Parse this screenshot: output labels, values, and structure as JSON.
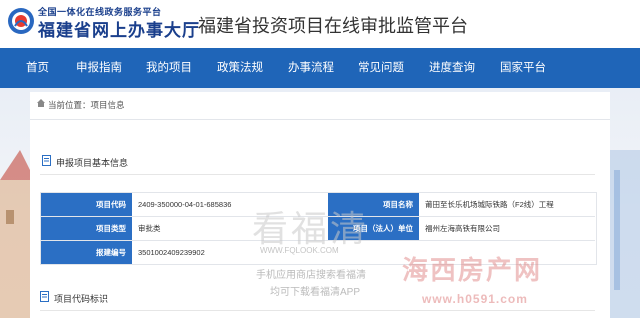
{
  "header": {
    "logo_sub": "全国一体化在线政务服务平台",
    "logo_main": "福建省网上办事大厅",
    "site_title": "福建省投资项目在线审批监管平台"
  },
  "nav": {
    "items": [
      "首页",
      "申报指南",
      "我的项目",
      "政策法规",
      "办事流程",
      "常见问题",
      "进度查询",
      "国家平台"
    ]
  },
  "breadcrumb": {
    "label": "当前位置：项目信息"
  },
  "section1": {
    "title": "申报项目基本信息"
  },
  "info_table": {
    "rows": [
      {
        "label1": "项目代码",
        "value1": "2409-350000-04-01-685836",
        "label2": "项目名称",
        "value2": "莆田至长乐机场城际铁路（F2线）工程"
      },
      {
        "label1": "项目类型",
        "value1": "审批类",
        "label2": "项目（法人）单位",
        "value2": "福州左海高铁有限公司"
      },
      {
        "label1": "报建编号",
        "value1": "3501002409239902",
        "label2": "",
        "value2": ""
      }
    ]
  },
  "section2": {
    "title": "项目代码标识"
  },
  "watermarks": {
    "brand": "看福清",
    "url": "WWW.FQLOOK.COM",
    "line1": "手机应用商店搜索看福清",
    "line2": "均可下载看福清APP",
    "brand2": "海西房产网",
    "url2": "www.h0591.com"
  },
  "colors": {
    "nav_bg": "#1f65b8",
    "label_bg": "#2b6fc4",
    "brand_blue": "#1a3f8c"
  }
}
